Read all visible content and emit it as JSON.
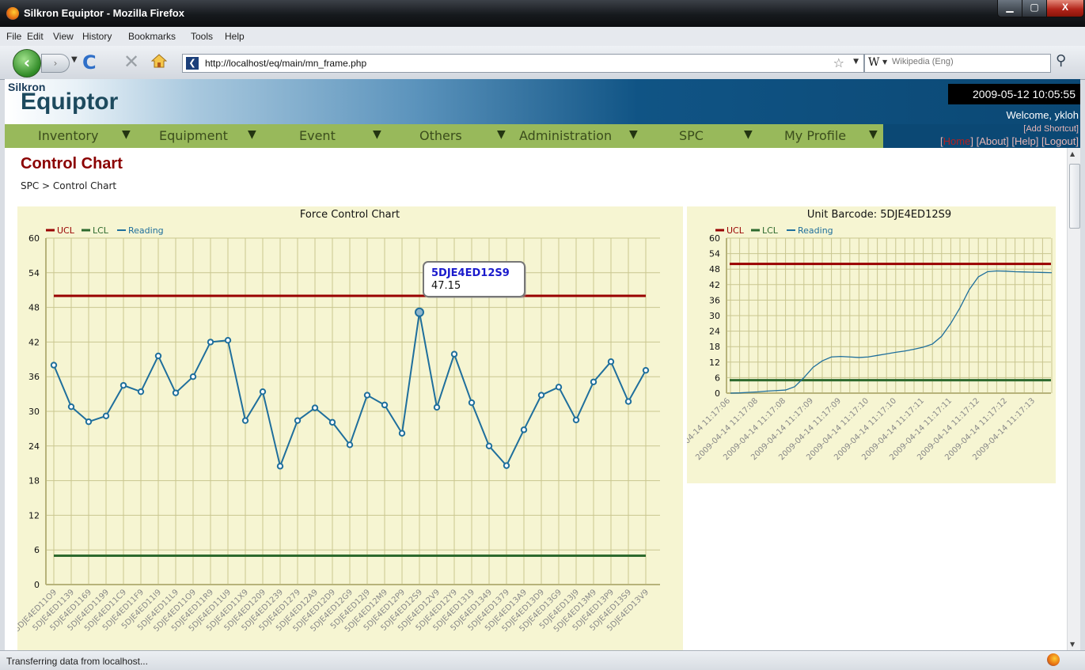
{
  "window": {
    "title": "Silkron Equiptor - Mozilla Firefox"
  },
  "menubar": {
    "items": [
      "File",
      "Edit",
      "View",
      "History",
      "Bookmarks",
      "Tools",
      "Help"
    ]
  },
  "navbar": {
    "url": "http://localhost/eq/main/mn_frame.php",
    "search_engine_icon": "W",
    "search_placeholder": "Wikipedia (Eng)"
  },
  "header": {
    "logo_top": "Silkron",
    "logo_main": "Equiptor",
    "datetime": "2009-05-12 10:05:55",
    "welcome": "Welcome, ykloh",
    "add_shortcut": "[Add Shortcut]",
    "links": [
      "Home",
      "About",
      "Help",
      "Logout"
    ]
  },
  "mainnav": {
    "items": [
      "Inventory",
      "Equipment",
      "Event",
      "Others",
      "Administration",
      "SPC",
      "My Profile"
    ]
  },
  "page": {
    "title": "Control Chart",
    "breadcrumb": "SPC > Control Chart"
  },
  "status": {
    "text": "Transferring data from localhost..."
  },
  "colors": {
    "ucl": "#990000",
    "lcl": "#2e6a2e",
    "reading": "#1f6f9c",
    "chart_bg": "#f6f5d2",
    "grid": "#c9c68f",
    "nav_bg": "#98b95b"
  },
  "chart_data": [
    {
      "type": "line",
      "title": "Force Control Chart",
      "legend": [
        "UCL",
        "LCL",
        "Reading"
      ],
      "ylim": [
        0,
        60
      ],
      "yticks": [
        0,
        6,
        12,
        18,
        24,
        30,
        36,
        42,
        48,
        54,
        60
      ],
      "ucl": 50,
      "lcl": 5,
      "categories": [
        "5DJE4ED11O9",
        "5DJE4ED1139",
        "5DJE4ED1169",
        "5DJE4ED1199",
        "5DJE4ED11C9",
        "5DJE4ED11F9",
        "5DJE4ED11I9",
        "5DJE4ED11L9",
        "5DJE4ED11O9",
        "5DJE4ED11R9",
        "5DJE4ED11U9",
        "5DJE4ED11X9",
        "5DJE4ED1209",
        "5DJE4ED1239",
        "5DJE4ED1279",
        "5DJE4ED12A9",
        "5DJE4ED12D9",
        "5DJE4ED12G9",
        "5DJE4ED12J9",
        "5DJE4ED12M9",
        "5DJE4ED12P9",
        "5DJE4ED12S9",
        "5DJE4ED12V9",
        "5DJE4ED12Y9",
        "5DJE4ED1319",
        "5DJE4ED1349",
        "5DJE4ED1379",
        "5DJE4ED13A9",
        "5DJE4ED13D9",
        "5DJE4ED13G9",
        "5DJE4ED13J9",
        "5DJE4ED13M9",
        "5DJE4ED13P9",
        "5DJE4ED13S9",
        "5DJE4ED13V9"
      ],
      "values": [
        38,
        30.8,
        28.2,
        29.2,
        34.5,
        33.4,
        39.6,
        33.2,
        36,
        42,
        42.3,
        28.4,
        33.4,
        20.5,
        28.4,
        30.6,
        28.1,
        24.2,
        32.8,
        31.1,
        26.2,
        47.15,
        30.7,
        39.9,
        31.5,
        24,
        20.6,
        26.8,
        32.8,
        34.2,
        28.5,
        35.1,
        38.6,
        31.7,
        37.1
      ],
      "tooltip": {
        "label": "5DJE4ED12S9",
        "value": "47.15"
      }
    },
    {
      "type": "line",
      "title": "Unit Barcode: 5DJE4ED12S9",
      "legend": [
        "UCL",
        "LCL",
        "Reading"
      ],
      "ylim": [
        0,
        60
      ],
      "yticks": [
        0,
        6,
        12,
        18,
        24,
        30,
        36,
        42,
        48,
        54,
        60
      ],
      "ucl": 50,
      "lcl": 5,
      "categories": [
        "2009-04-14 11:17:06",
        "2009-04-14 11:17:08",
        "2009-04-14 11:17:08",
        "2009-04-14 11:17:09",
        "2009-04-14 11:17:09",
        "2009-04-14 11:17:10",
        "2009-04-14 11:17:10",
        "2009-04-14 11:17:11",
        "2009-04-14 11:17:11",
        "2009-04-14 11:17:12",
        "2009-04-14 11:17:12",
        "2009-04-14 11:17:13"
      ],
      "values": [
        0,
        1,
        2,
        12,
        14,
        15,
        16,
        19,
        34,
        47,
        47,
        46.5
      ],
      "x_count": 36,
      "points": [
        0,
        0.1,
        0.3,
        0.5,
        0.8,
        1,
        1.2,
        2.5,
        6,
        10,
        12.5,
        14,
        14.2,
        14,
        13.8,
        14,
        14.6,
        15.2,
        15.8,
        16.3,
        17,
        17.8,
        19,
        22,
        27,
        33,
        40,
        45,
        47,
        47.3,
        47.2,
        47,
        46.9,
        46.8,
        46.7,
        46.6
      ]
    }
  ]
}
